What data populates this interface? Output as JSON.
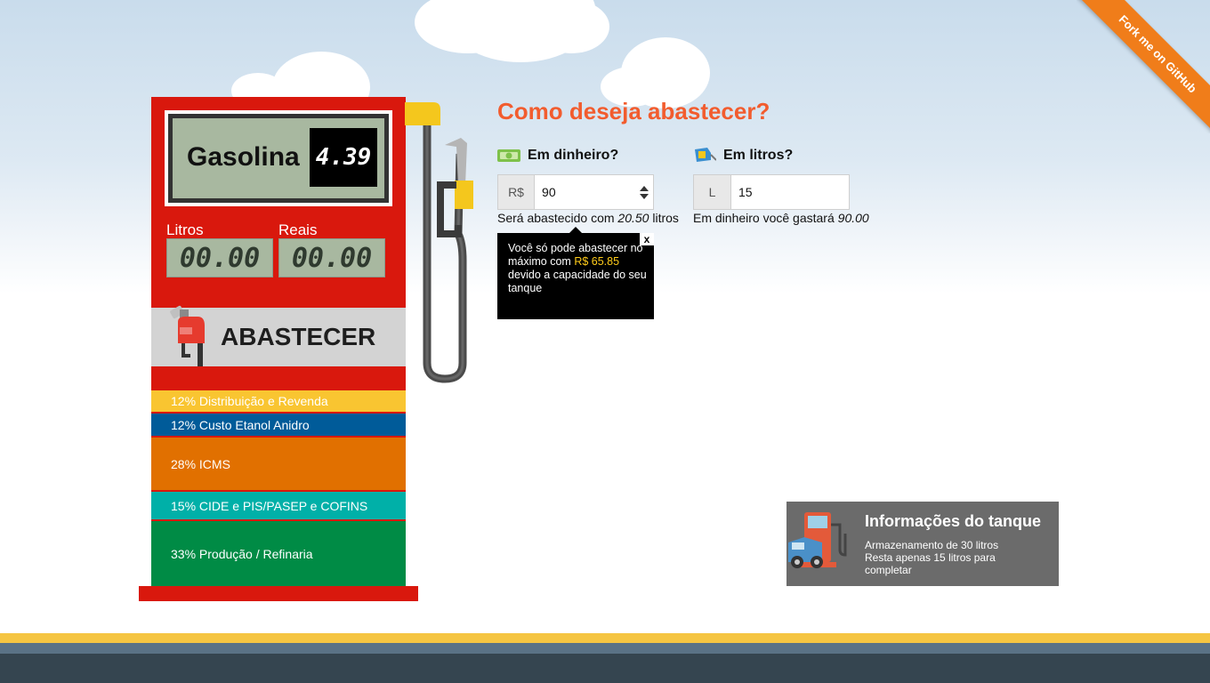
{
  "ribbon": {
    "label": "Fork me on GitHub"
  },
  "pump": {
    "fuel_name": "Gasolina",
    "price": "4.39",
    "litros_label": "Litros",
    "reais_label": "Reais",
    "litros_value": "00.00",
    "reais_value": "00.00",
    "button_label": "ABASTECER",
    "bands": [
      {
        "label": "12% Distribuição e Revenda",
        "color": "#f9c531"
      },
      {
        "label": "12% Custo Etanol Anidro",
        "color": "#005b99"
      },
      {
        "label": "28% ICMS",
        "color": "#e17000"
      },
      {
        "label": "15% CIDE e PIS/PASEP e COFINS",
        "color": "#00b0a8"
      },
      {
        "label": "33% Produção / Refinaria",
        "color": "#008b45"
      }
    ]
  },
  "form": {
    "question": "Como deseja abastecer?",
    "money": {
      "title": "Em dinheiro?",
      "icon": "money-icon",
      "addon": "R$",
      "value": "90",
      "help_prefix": "Será abastecido com",
      "help_value": "20.50",
      "help_suffix": "litros"
    },
    "liters": {
      "title": "Em litros?",
      "icon": "fuel-nozzle-icon",
      "addon": "L",
      "value": "15",
      "help_prefix": "Em dinheiro você gastará",
      "help_value": "90.00"
    },
    "tooltip": {
      "close": "x",
      "text_before": "Você só pode abastecer no máximo com",
      "highlight": "R$ 65.85",
      "text_after": "devido a capacidade do seu tanque"
    }
  },
  "tank": {
    "title": "Informações do tanque",
    "line1": "Armazenamento de 30 litros",
    "line2": "Resta apenas 15 litros para completar"
  },
  "colors": {
    "pump_red": "#d9180d",
    "accent_orange": "#f25c2e",
    "ribbon_orange": "#f07d1a",
    "footer_dark": "#354550"
  }
}
